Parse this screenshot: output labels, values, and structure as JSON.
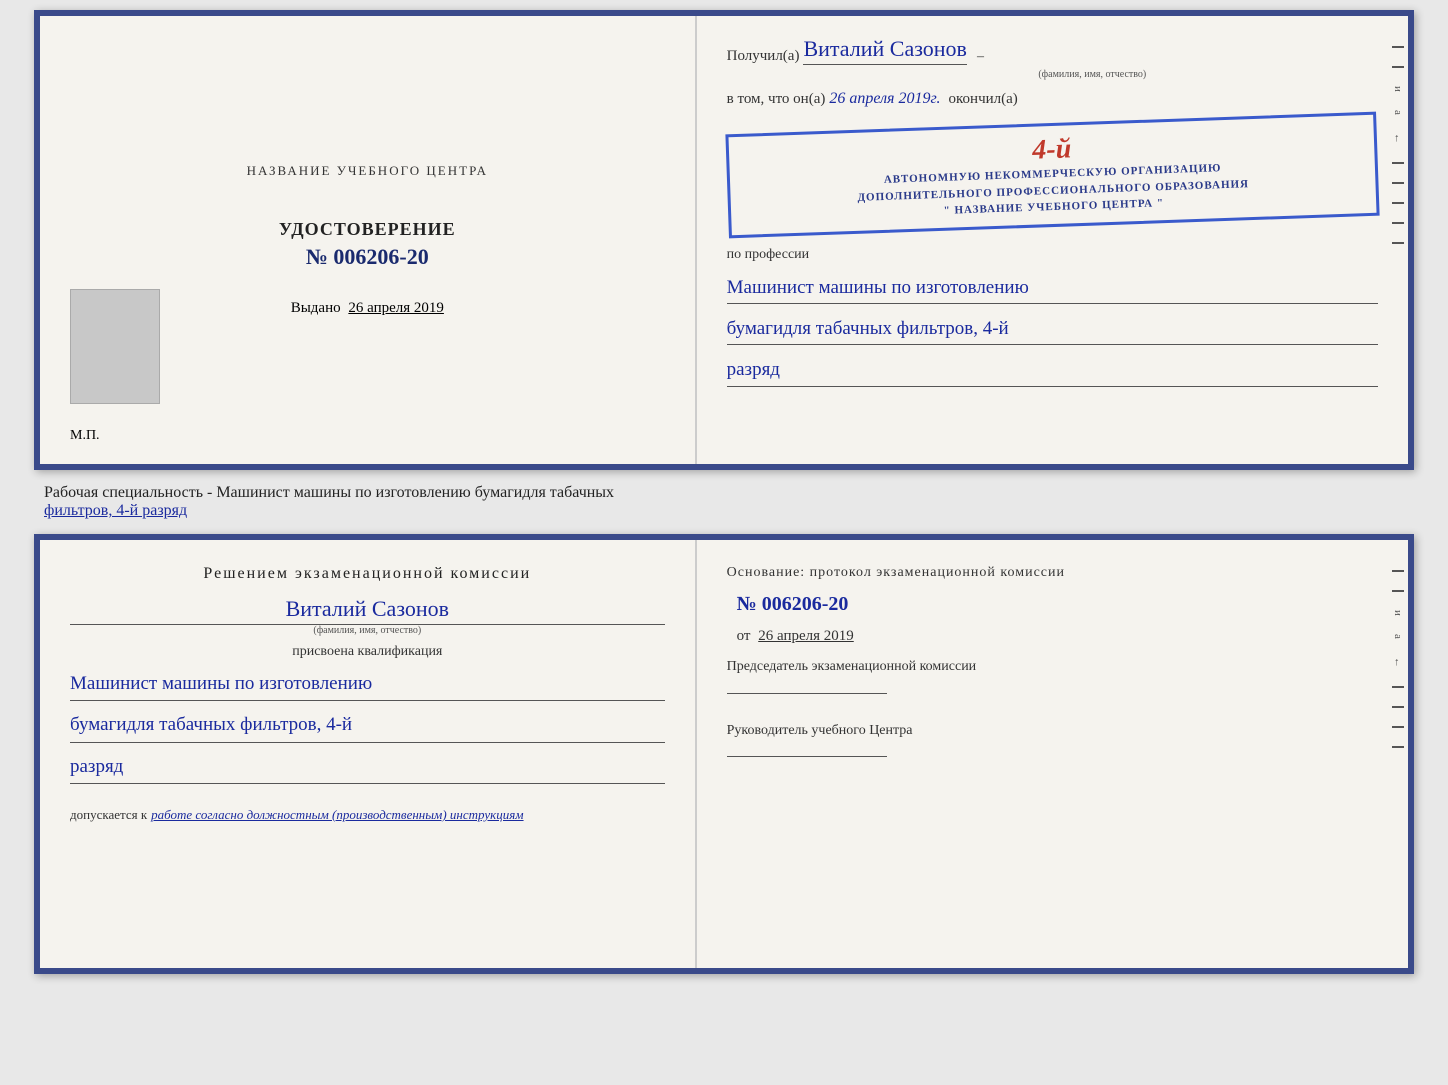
{
  "topDoc": {
    "leftLabel": "НАЗВАНИЕ УЧЕБНОГО ЦЕНТРА",
    "title": "УДОСТОВЕРЕНИЕ",
    "number": "№ 006206-20",
    "vydanoLabel": "Выдано",
    "vydanoDate": "26 апреля 2019",
    "mpLabel": "М.П.",
    "receivedPrefix": "Получил(а)",
    "receivedName": "Виталий Сазонов",
    "nameSub": "(фамилия, имя, отчество)",
    "vtomPrefix": "в том, что он(а)",
    "vtomDate": "26 апреля 2019г.",
    "vtomSuffix": "окончил(а)",
    "stampNumber": "4-й",
    "stampLine1": "АВТОНОМНУЮ НЕКОММЕРЧЕСКУЮ ОРГАНИЗАЦИЮ",
    "stampLine2": "ДОПОЛНИТЕЛЬНОГО ПРОФЕССИОНАЛЬНОГО ОБРАЗОВАНИЯ",
    "stampLine3": "\" НАЗВАНИЕ УЧЕБНОГО ЦЕНТРА \"",
    "profLabel": "по профессии",
    "prof1": "Машинист машины по изготовлению",
    "prof2": "бумагидля табачных фильтров, 4-й",
    "prof3": "разряд"
  },
  "middleText": {
    "line1": "Рабочая специальность - Машинист машины по изготовлению бумагидля табачных",
    "line2": "фильтров, 4-й разряд"
  },
  "bottomDoc": {
    "komissia": "Решением экзаменационной комиссии",
    "fio": "Виталий Сазонов",
    "fioSub": "(фамилия, имя, отчество)",
    "prisvoena": "присвоена квалификация",
    "qual1": "Машинист машины по изготовлению",
    "qual2": "бумагидля табачных фильтров, 4-й",
    "qual3": "разряд",
    "dopuskaetsyaPrefix": "допускается к",
    "dopuskaetsyaText": "работе согласно должностным (производственным) инструкциям",
    "osnov": "Основание: протокол экзаменационной комиссии",
    "protokolNumber": "№ 006206-20",
    "otLabel": "от",
    "otDate": "26 апреля 2019",
    "chairman": "Председатель экзаменационной комиссии",
    "rukovoditel": "Руководитель учебного Центра"
  }
}
